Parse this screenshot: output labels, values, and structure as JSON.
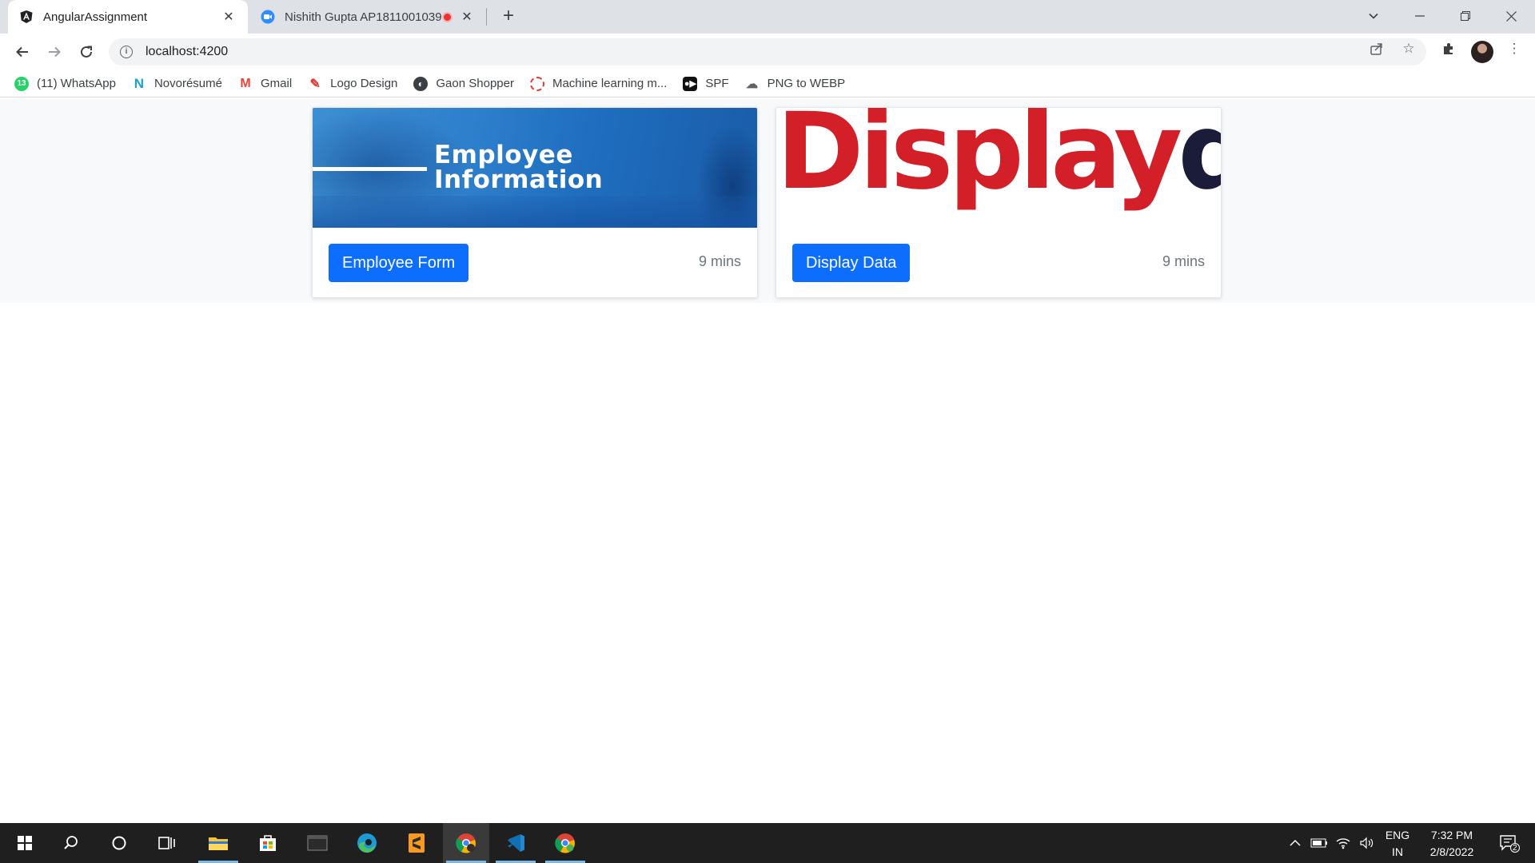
{
  "browser": {
    "tabs": [
      {
        "title": "AngularAssignment",
        "active": true,
        "icon": "angular-icon"
      },
      {
        "title": "Nishith Gupta AP1811001039",
        "active": false,
        "icon": "zoom-icon",
        "recording": true
      }
    ],
    "address": "localhost:4200",
    "bookmarks": [
      {
        "label": "(11) WhatsApp",
        "icon": "whatsapp-icon",
        "badge": "13"
      },
      {
        "label": "Novorésumé",
        "icon": "novoresume-icon"
      },
      {
        "label": "Gmail",
        "icon": "gmail-icon"
      },
      {
        "label": "Logo Design",
        "icon": "logo-design-icon"
      },
      {
        "label": "Gaon Shopper",
        "icon": "globe-icon"
      },
      {
        "label": "Machine learning m...",
        "icon": "ml-icon"
      },
      {
        "label": "SPF",
        "icon": "spf-icon"
      },
      {
        "label": "PNG to WEBP",
        "icon": "cloud-icon"
      }
    ]
  },
  "cards": [
    {
      "image_caption_line1": "Employee",
      "image_caption_line2": "Information",
      "button": "Employee Form",
      "time": "9 mins"
    },
    {
      "image_word_1": "Display",
      "image_word_2": "data",
      "button": "Display Data",
      "time": "9 mins"
    }
  ],
  "taskbar": {
    "language": "ENG",
    "region": "IN",
    "time": "7:32 PM",
    "date": "2/8/2022",
    "notifications": "2"
  },
  "colors": {
    "primary_button": "#0d6efd",
    "display_red": "#d32028",
    "display_navy": "#1b1b3a"
  }
}
